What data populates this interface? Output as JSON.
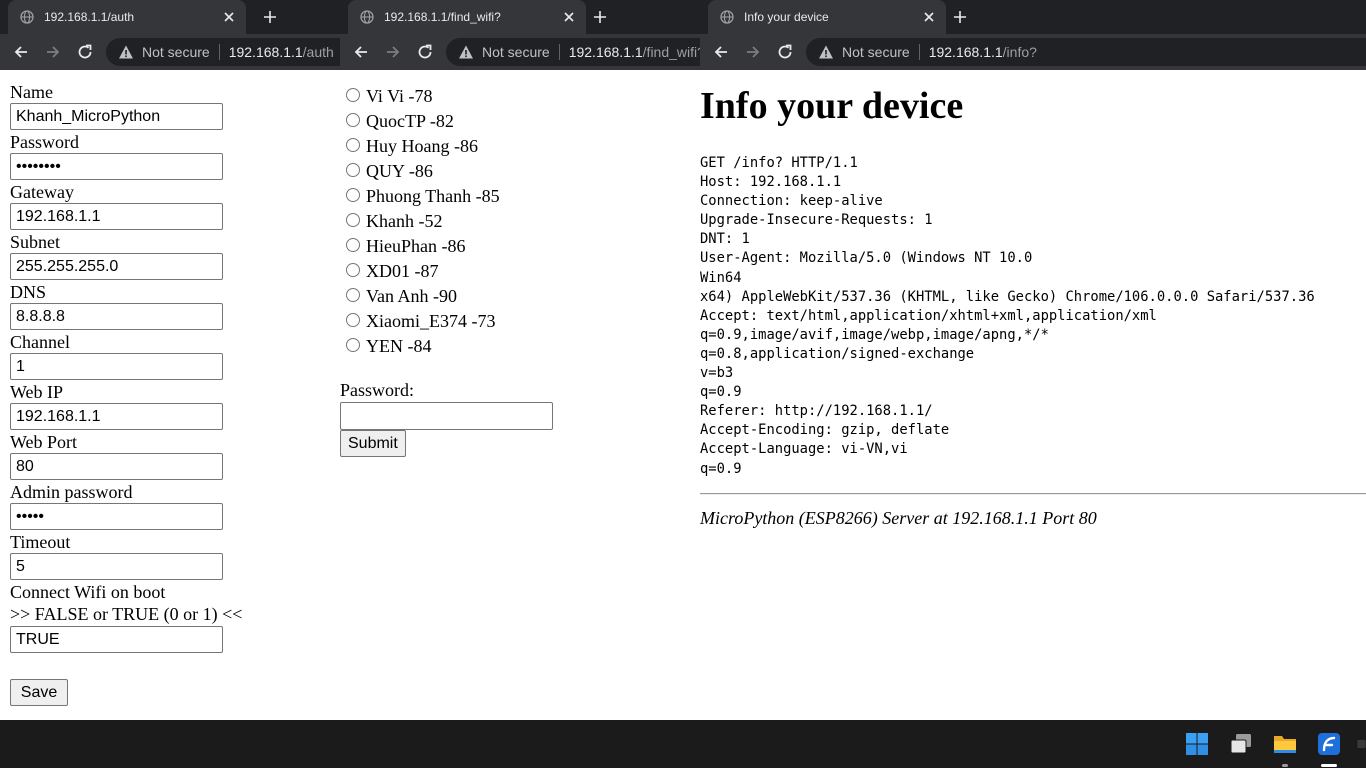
{
  "win1": {
    "tab_title": "192.168.1.1/auth",
    "not_secure": "Not secure",
    "host": "192.168.1.1",
    "path": "/auth",
    "fields": [
      {
        "label": "Name",
        "value": "Khanh_MicroPython"
      },
      {
        "label": "Password",
        "value": "••••••••"
      },
      {
        "label": "Gateway",
        "value": "192.168.1.1"
      },
      {
        "label": "Subnet",
        "value": "255.255.255.0"
      },
      {
        "label": "DNS",
        "value": "8.8.8.8"
      },
      {
        "label": "Channel",
        "value": "1"
      },
      {
        "label": "Web IP",
        "value": "192.168.1.1"
      },
      {
        "label": "Web Port",
        "value": "80"
      },
      {
        "label": "Admin password",
        "value": "•••••"
      },
      {
        "label": "Timeout",
        "value": "5"
      }
    ],
    "boot_label": "Connect Wifi on boot",
    "boot_hint": ">> FALSE or TRUE (0 or 1) <<",
    "boot_value": "TRUE",
    "save_label": "Save"
  },
  "win2": {
    "tab_title": "192.168.1.1/find_wifi?",
    "not_secure": "Not secure",
    "host": "192.168.1.1",
    "path": "/find_wifi?",
    "networks": [
      "Vi Vi -78",
      "QuocTP -82",
      "Huy Hoang -86",
      "QUY -86",
      "Phuong Thanh -85",
      "Khanh -52",
      "HieuPhan -86",
      "XD01 -87",
      "Van Anh -90",
      "Xiaomi_E374 -73",
      "YEN -84"
    ],
    "password_label": "Password:",
    "password_value": "",
    "submit_label": "Submit"
  },
  "win3": {
    "tab_title": "Info your device",
    "not_secure": "Not secure",
    "host": "192.168.1.1",
    "path": "/info?",
    "heading": "Info your device",
    "request_lines": "GET /info? HTTP/1.1\nHost: 192.168.1.1\nConnection: keep-alive\nUpgrade-Insecure-Requests: 1\nDNT: 1\nUser-Agent: Mozilla/5.0 (Windows NT 10.0\nWin64\nx64) AppleWebKit/537.36 (KHTML, like Gecko) Chrome/106.0.0.0 Safari/537.36\nAccept: text/html,application/xhtml+xml,application/xml\nq=0.9,image/avif,image/webp,image/apng,*/*\nq=0.8,application/signed-exchange\nv=b3\nq=0.9\nReferer: http://192.168.1.1/\nAccept-Encoding: gzip, deflate\nAccept-Language: vi-VN,vi\nq=0.9",
    "footer": "MicroPython (ESP8266) Server at 192.168.1.1 Port 80"
  },
  "taskbar": {
    "icons": [
      "windows-start-icon",
      "task-view-icon",
      "file-explorer-icon",
      "app-icon"
    ]
  }
}
